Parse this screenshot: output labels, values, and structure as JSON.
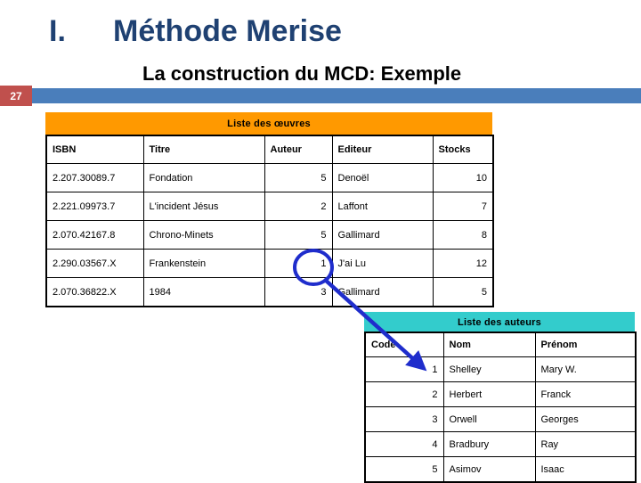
{
  "slide": {
    "number": "27",
    "title_numeral": "I.",
    "title": "Méthode Merise",
    "subtitle": "La construction du MCD: Exemple",
    "colors": {
      "title": "#1F4172",
      "rule": "#4A7EBB",
      "badge": "#C0504D",
      "banner_oeuvres": "#FF9900",
      "banner_auteurs": "#33CCCC",
      "annotation": "#1F2DCC"
    }
  },
  "table_oeuvres": {
    "banner": "Liste des œuvres",
    "columns": [
      "ISBN",
      "Titre",
      "Auteur",
      "Editeur",
      "Stocks"
    ],
    "rows": [
      {
        "isbn": "2.207.30089.7",
        "titre": "Fondation",
        "auteur": "5",
        "editeur": "Denoël",
        "stocks": "10"
      },
      {
        "isbn": "2.221.09973.7",
        "titre": "L'incident Jésus",
        "auteur": "2",
        "editeur": "Laffont",
        "stocks": "7"
      },
      {
        "isbn": "2.070.42167.8",
        "titre": "Chrono-Minets",
        "auteur": "5",
        "editeur": "Gallimard",
        "stocks": "8"
      },
      {
        "isbn": "2.290.03567.X",
        "titre": "Frankenstein",
        "auteur": "1",
        "editeur": "J'ai Lu",
        "stocks": "12"
      },
      {
        "isbn": "2.070.36822.X",
        "titre": "1984",
        "auteur": "3",
        "editeur": "Gallimard",
        "stocks": "5"
      }
    ]
  },
  "table_auteurs": {
    "banner": "Liste des auteurs",
    "columns": [
      "Code",
      "Nom",
      "Prénom"
    ],
    "rows": [
      {
        "code": "1",
        "nom": "Shelley",
        "prenom": "Mary W."
      },
      {
        "code": "2",
        "nom": "Herbert",
        "prenom": "Franck"
      },
      {
        "code": "3",
        "nom": "Orwell",
        "prenom": "Georges"
      },
      {
        "code": "4",
        "nom": "Bradbury",
        "prenom": "Ray"
      },
      {
        "code": "5",
        "nom": "Asimov",
        "prenom": "Isaac"
      }
    ]
  },
  "annotation": {
    "kind": "circle-and-arrow",
    "circle_target": "auteur value 1 on Frankenstein row",
    "arrow_target": "code value 1 on Shelley row"
  }
}
